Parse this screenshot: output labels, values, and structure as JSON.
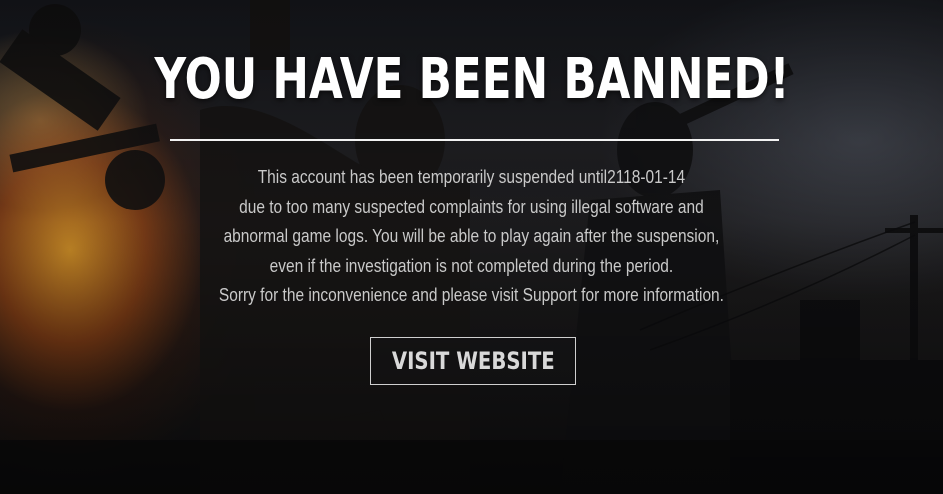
{
  "ban_screen": {
    "title": "YOU HAVE BEEN BANNED!",
    "message_lines": [
      "This account has been temporarily suspended until2118-01-14",
      "due to too many suspected complaints for using illegal software and",
      "abnormal game logs. You will be able to play again after the suspension,",
      "even if the investigation is not completed during the period.",
      "Sorry for the inconvenience and please visit Support for more information."
    ],
    "visit_button_label": "VISIT WEBSITE"
  },
  "colors": {
    "title": "#ffffff",
    "message": "#c9c9c9",
    "divider": "#f2f2f2",
    "button_border": "#cfcfcf",
    "fire_glow": "#ffaf2d"
  }
}
